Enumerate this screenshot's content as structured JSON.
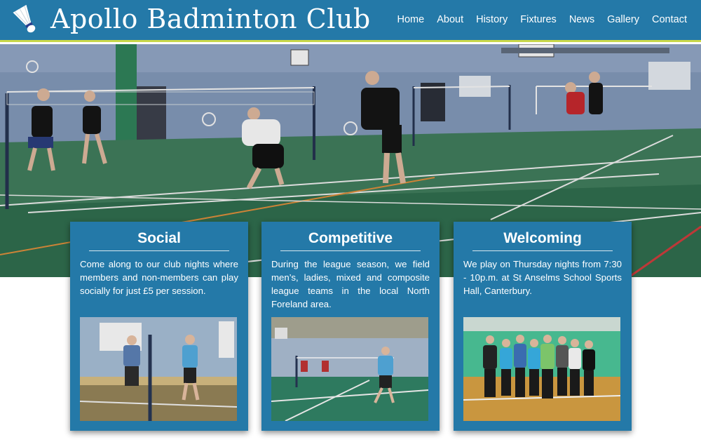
{
  "header": {
    "title": "Apollo Badminton Club",
    "logo_icon": "shuttlecock-icon"
  },
  "nav": {
    "items": [
      {
        "label": "Home"
      },
      {
        "label": "About"
      },
      {
        "label": "History"
      },
      {
        "label": "Fixtures"
      },
      {
        "label": "News"
      },
      {
        "label": "Gallery"
      },
      {
        "label": "Contact"
      }
    ]
  },
  "cards": [
    {
      "title": "Social",
      "text": "Come along to our club nights where members and non-members can play socially for just £5 per session."
    },
    {
      "title": "Competitive",
      "text": "During the league season, we field men’s, ladies, mixed and composite league teams in the local North Foreland area."
    },
    {
      "title": "Welcoming",
      "text": "We play on Thursday nights from 7:30 - 10p.m. at St Anselms School Sports Hall, Canterbury."
    }
  ],
  "colors": {
    "brand_blue": "#2479a8",
    "accent_green": "#c9d84a"
  }
}
